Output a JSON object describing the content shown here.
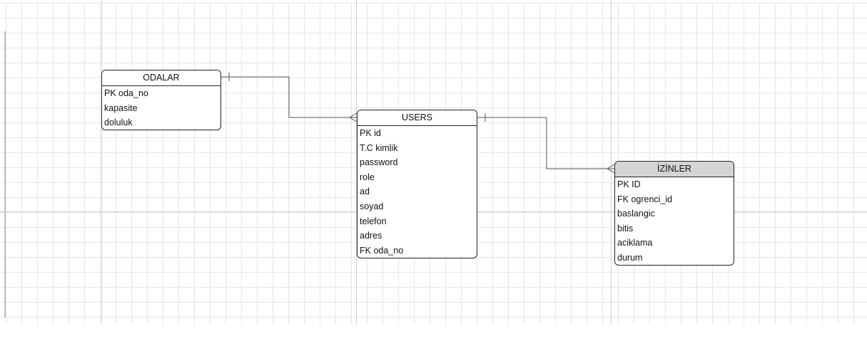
{
  "entities": {
    "odalar": {
      "title": "ODALAR",
      "fields": [
        "PK oda_no",
        "kapasite",
        "doluluk"
      ]
    },
    "users": {
      "title": "USERS",
      "fields": [
        "PK id",
        "T.C kimlik",
        "password",
        "role",
        "ad",
        "soyad",
        "telefon",
        "adres",
        "FK oda_no"
      ]
    },
    "izinler": {
      "title": "İZİNLER",
      "fields": [
        "PK ID",
        "FK ogrenci_id",
        "baslangic",
        "bitis",
        "aciklama",
        "durum"
      ]
    }
  },
  "relations": [
    {
      "from": "ODALAR",
      "to": "USERS",
      "from_end": "one",
      "to_end": "many"
    },
    {
      "from": "USERS",
      "to": "İZİNLER",
      "from_end": "one",
      "to_end": "many"
    }
  ],
  "colors": {
    "grid_minor": "#e6e6e6",
    "grid_major": "#cfcfcf",
    "border": "#222222",
    "connector": "#555555",
    "shaded_header": "#d4d4d4"
  }
}
